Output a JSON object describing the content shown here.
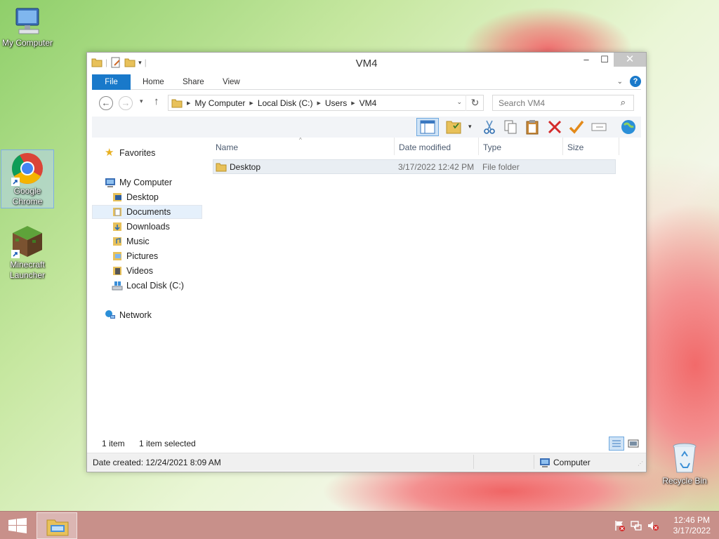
{
  "desktop": {
    "icons": [
      {
        "label": "My Computer",
        "icon": "my-computer-icon"
      },
      {
        "label": "Google Chrome",
        "icon": "chrome-icon"
      },
      {
        "label": "Minecraft Launcher",
        "icon": "minecraft-icon"
      },
      {
        "label": "Recycle Bin",
        "icon": "recycle-bin-icon"
      }
    ]
  },
  "window": {
    "title": "VM4",
    "controls": {
      "minimize": "–",
      "maximize": "☐",
      "close": "✕"
    },
    "ribbon": {
      "tabs": [
        "File",
        "Home",
        "Share",
        "View"
      ]
    },
    "address": {
      "crumbs": [
        "My Computer",
        "Local Disk (C:)",
        "Users",
        "VM4"
      ]
    },
    "search": {
      "placeholder": "Search VM4"
    },
    "nav": {
      "favorites": "Favorites",
      "computer": "My Computer",
      "computer_children": [
        "Desktop",
        "Documents",
        "Downloads",
        "Music",
        "Pictures",
        "Videos",
        "Local Disk (C:)"
      ],
      "selected": "Documents",
      "network": "Network"
    },
    "columns": [
      "Name",
      "Date modified",
      "Type",
      "Size"
    ],
    "files": [
      {
        "name": "Desktop",
        "date": "3/17/2022 12:42 PM",
        "type": "File folder",
        "size": ""
      }
    ],
    "status": {
      "count": "1 item",
      "selected": "1 item selected",
      "details": "Date created: 12/24/2021 8:09 AM",
      "location": "Computer"
    }
  },
  "taskbar": {
    "time": "12:46 PM",
    "date": "3/17/2022"
  },
  "colors": {
    "accent": "#1979ca",
    "taskbar": "#c8908a",
    "folder": "#e8c15a"
  }
}
